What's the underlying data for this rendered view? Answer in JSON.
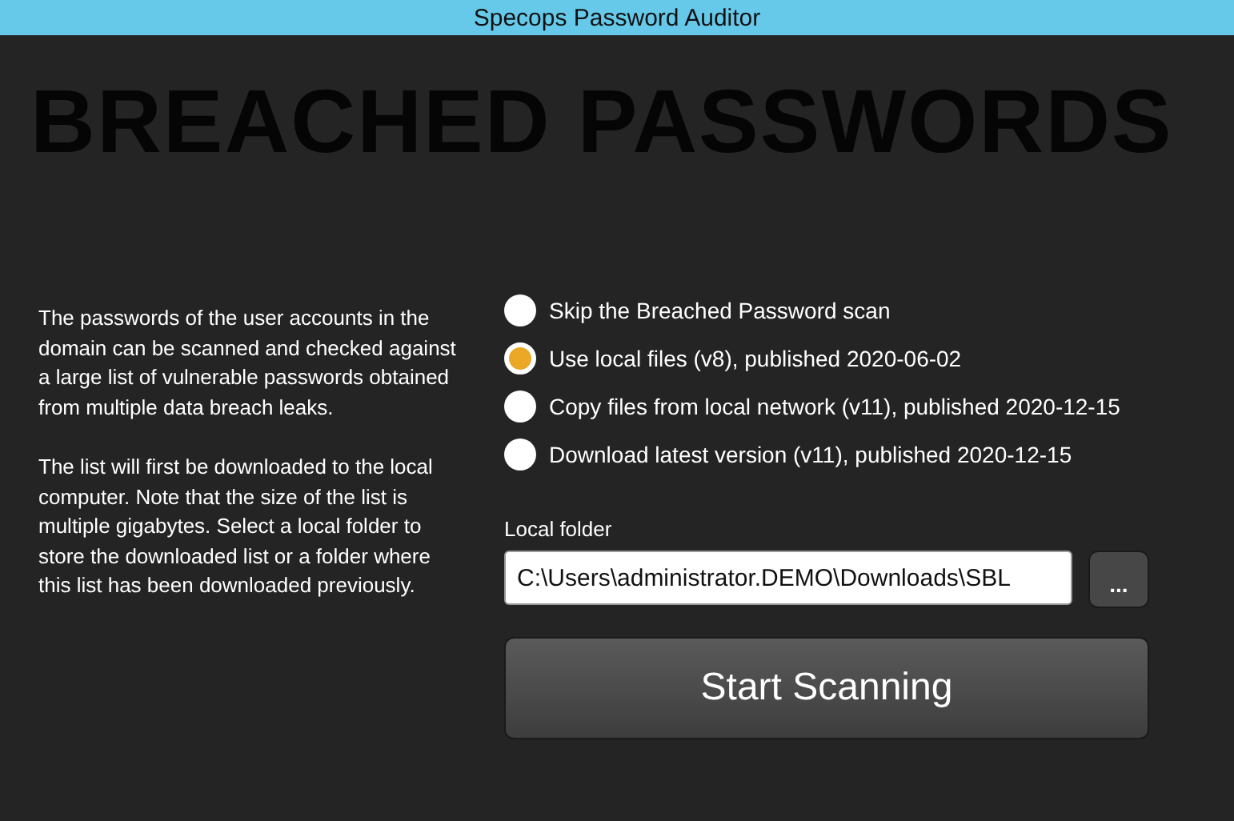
{
  "window": {
    "title": "Specops Password Auditor"
  },
  "heading": "BREACHED PASSWORDS",
  "description": [
    "The passwords of the user accounts in the domain can be scanned and checked against a large list of vulnerable passwords obtained from multiple data breach leaks.",
    "The list will first be downloaded to the local computer. Note that the size of the list is multiple gigabytes. Select a local folder to store the downloaded list or a folder where this list has been downloaded previously."
  ],
  "options": [
    {
      "label": "Skip the Breached Password scan",
      "selected": false
    },
    {
      "label": "Use local files (v8), published 2020-06-02",
      "selected": true
    },
    {
      "label": "Copy files from local network (v11), published 2020-12-15",
      "selected": false
    },
    {
      "label": "Download latest version (v11), published 2020-12-15",
      "selected": false
    }
  ],
  "local_folder": {
    "label": "Local folder",
    "value": "C:\\Users\\administrator.DEMO\\Downloads\\SBL",
    "browse": "..."
  },
  "start_button": "Start Scanning"
}
